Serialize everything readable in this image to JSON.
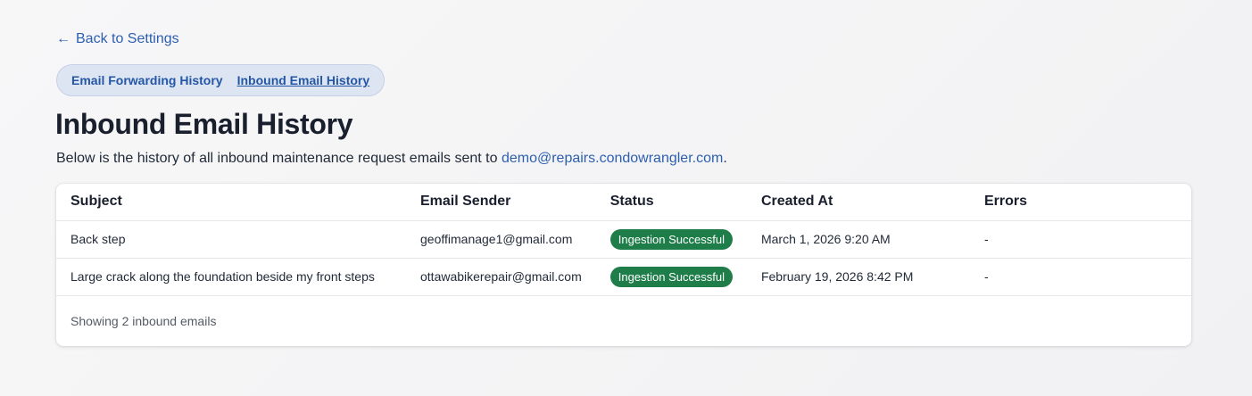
{
  "nav": {
    "back_arrow": "←",
    "back_label": "Back to Settings"
  },
  "tabs": [
    {
      "label": "Email Forwarding History",
      "active": false
    },
    {
      "label": "Inbound Email History",
      "active": true
    }
  ],
  "page": {
    "title": "Inbound Email History",
    "description_prefix": "Below is the history of all inbound maintenance request emails sent to ",
    "description_email": "demo@repairs.condowrangler.com",
    "description_suffix": "."
  },
  "table": {
    "headers": {
      "subject": "Subject",
      "sender": "Email Sender",
      "status": "Status",
      "created": "Created At",
      "errors": "Errors"
    },
    "rows": [
      {
        "subject": "Back step",
        "sender": "geoffimanage1@gmail.com",
        "status": "Ingestion Successful",
        "created": "March 1, 2026 9:20 AM",
        "errors": "-"
      },
      {
        "subject": "Large crack along the foundation beside my front steps",
        "sender": "ottawabikerepair@gmail.com",
        "status": "Ingestion Successful",
        "created": "February 19, 2026 8:42 PM",
        "errors": "-"
      }
    ],
    "footer": "Showing 2 inbound emails"
  },
  "colors": {
    "link": "#2d5fb0",
    "tab_bg": "#dde5f2",
    "badge_success": "#1f7d4a"
  }
}
